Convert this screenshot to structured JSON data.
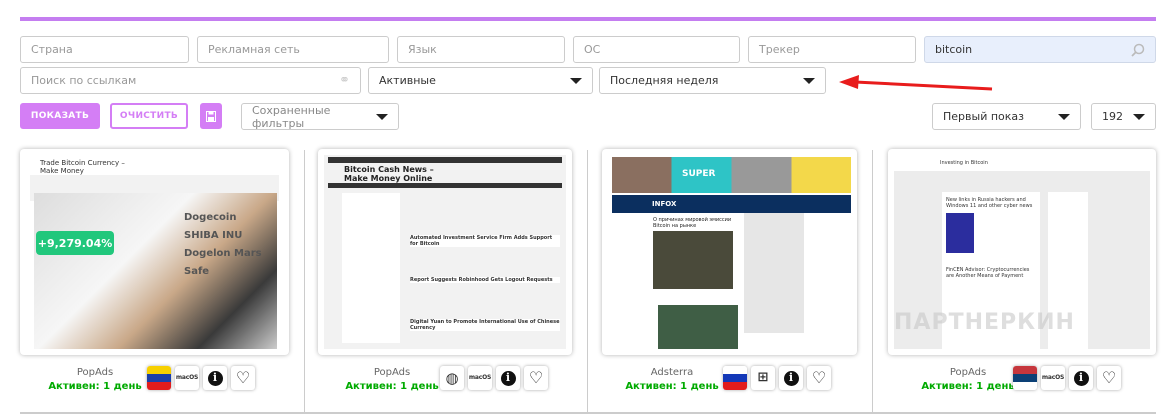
{
  "filters": {
    "country_placeholder": "Страна",
    "adnetwork_placeholder": "Рекламная сеть",
    "language_placeholder": "Язык",
    "os_placeholder": "ОС",
    "tracker_placeholder": "Трекер",
    "search_value": "bitcoin",
    "link_search_placeholder": "Поиск по ссылкам",
    "status_select": "Активные",
    "period_select": "Последняя неделя",
    "show_button": "ПОКАЗАТЬ",
    "clear_button": "ОЧИСТИТЬ",
    "saved_filters": "Сохраненные фильтры",
    "sort_select": "Первый показ",
    "per_page_select": "192"
  },
  "annotation_color": "#e81c1c",
  "accent_color": "#d47ef5",
  "cards": [
    {
      "network": "PopAds",
      "status": "Активен: 1 день",
      "flag": "venezuela",
      "os": "macOS",
      "shot": {
        "title": "Trade Bitcoin Currency – Make Money",
        "headline": "+9,279.04%",
        "coins": [
          "Dogecoin",
          "SHIBA INU",
          "Dogelon Mars",
          "Safe"
        ]
      }
    },
    {
      "network": "PopAds",
      "status": "Активен: 1 день",
      "flag": "globe",
      "os": "macOS",
      "shot": {
        "title": "Bitcoin Cash News – Make Money Online",
        "posts": [
          "Automated Investment Service Firm Adds Support for Bitcoin",
          "Report Suggests Robinhood Gets Logout Requests",
          "Digital Yuan to Promote International Use of Chinese Currency"
        ]
      }
    },
    {
      "network": "Adsterra",
      "status": "Активен: 1 день",
      "flag": "russia",
      "os": "windows",
      "shot": {
        "banner": "SUPER",
        "logo": "INFOX",
        "title": "О причинах мировой эмиссии Bitcoin на рынке"
      }
    },
    {
      "network": "PopAds",
      "status": "Активен: 1 день",
      "flag": "serbia",
      "os": "macOS",
      "shot": {
        "title": "Investing in Bitcoin",
        "posts": [
          "New links in Russia hackers and Windows 11 and other cyber news",
          "FinCEN Advisor: Cryptocurrencies are Another Means of Payment"
        ],
        "watermark": "ПАРТНЕРКИН"
      }
    }
  ]
}
